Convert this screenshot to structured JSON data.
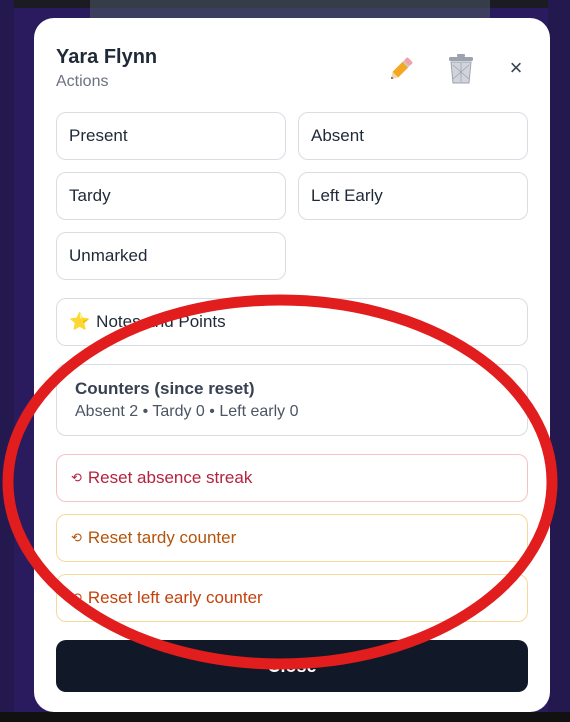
{
  "header": {
    "name": "Yara Flynn",
    "subtitle": "Actions",
    "close_symbol": "×"
  },
  "status_options": [
    {
      "label": "Present"
    },
    {
      "label": "Absent"
    },
    {
      "label": "Tardy"
    },
    {
      "label": "Left Early"
    },
    {
      "label": "Unmarked"
    }
  ],
  "notes": {
    "icon": "star-icon",
    "star": "⭐",
    "label": "Notes and Points"
  },
  "counters": {
    "title": "Counters (since reset)",
    "summary": "Absent 2 • Tardy 0 • Left early 0"
  },
  "resets": [
    {
      "icon": "⟲",
      "label": "Reset absence streak",
      "color": "#b4233e"
    },
    {
      "icon": "⟲",
      "label": "Reset tardy counter",
      "color": "#b45309"
    },
    {
      "icon": "⟲",
      "label": "Reset left early counter",
      "color": "#c2410c"
    }
  ],
  "footer": {
    "close_label": "Close"
  },
  "icons": {
    "edit": "pencil-icon",
    "delete": "trash-icon",
    "close": "close-icon"
  },
  "annotation": {
    "shape": "ellipse",
    "color": "#e11d1d"
  }
}
